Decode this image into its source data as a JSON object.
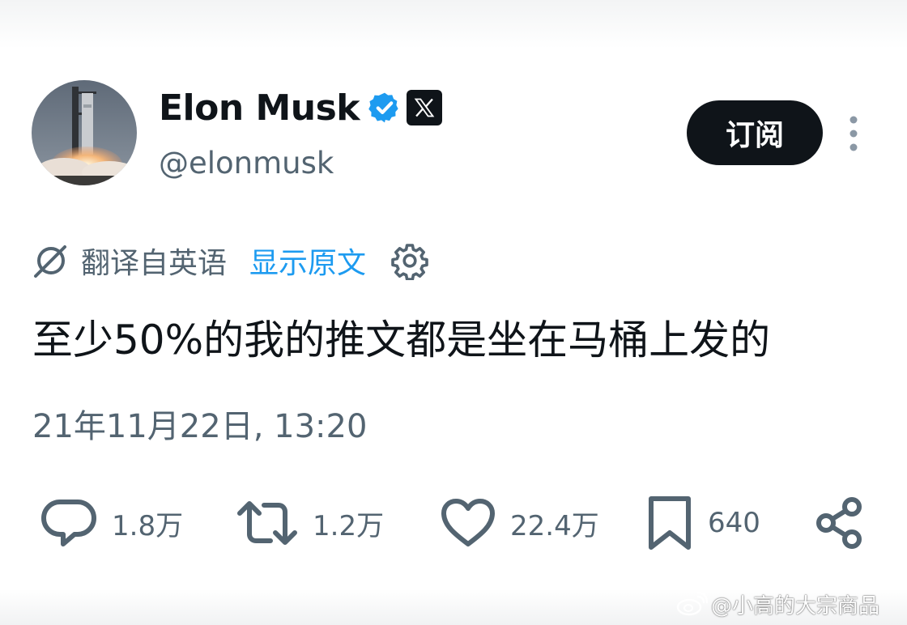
{
  "profile": {
    "name": "Elon Musk",
    "handle": "@elonmusk",
    "verified_color": "#1d9bf0"
  },
  "header": {
    "subscribe_label": "订阅"
  },
  "translation": {
    "translated_from": "翻译自英语",
    "show_original": "显示原文"
  },
  "tweet": {
    "text": "至少50%的我的推文都是坐在马桶上发的",
    "timestamp": "21年11月22日, 13:20"
  },
  "actions": {
    "replies": "1.8万",
    "retweets": "1.2万",
    "likes": "22.4万",
    "bookmarks": "640"
  },
  "watermark": {
    "text": "@小高的大宗商品"
  },
  "icons": {
    "avatar": "avatar",
    "verified": "verified-badge-icon",
    "x_logo": "x-logo-icon",
    "more": "more-vertical-icon",
    "translate": "translate-icon",
    "settings": "gear-icon",
    "reply": "reply-icon",
    "retweet": "retweet-icon",
    "like": "heart-icon",
    "bookmark": "bookmark-icon",
    "share": "share-icon",
    "weibo": "weibo-icon"
  },
  "colors": {
    "text_primary": "#0f1419",
    "text_secondary": "#536471",
    "accent": "#1d9bf0",
    "button_bg": "#0f1419"
  }
}
